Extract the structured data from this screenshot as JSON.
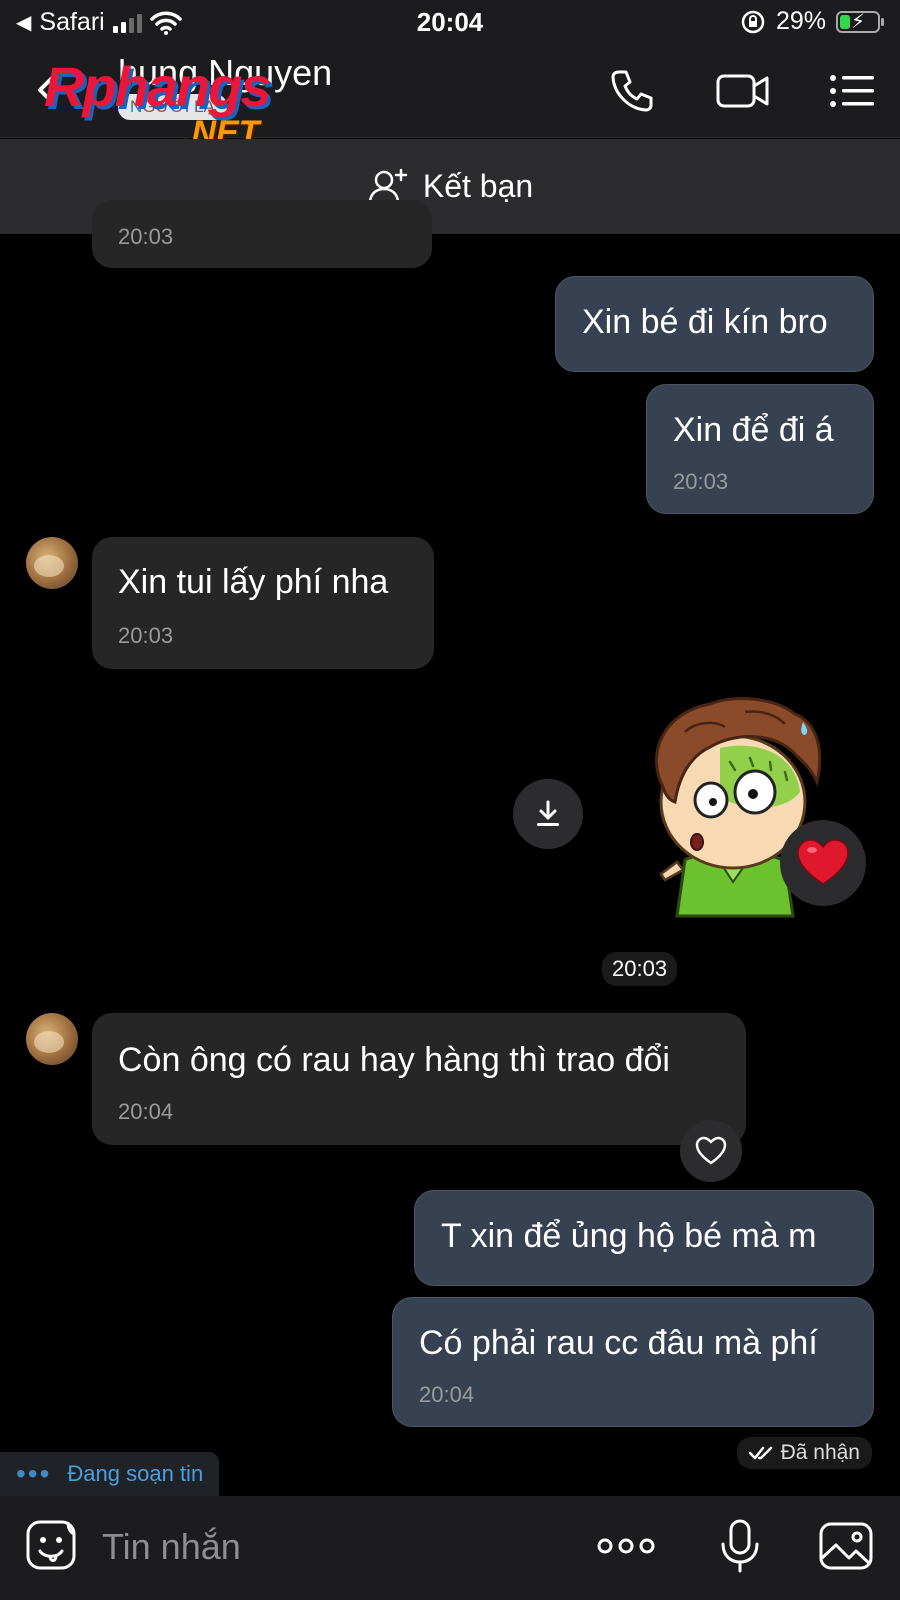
{
  "status_bar": {
    "back_app": "Safari",
    "time": "20:04",
    "battery": "29%",
    "battery_level": 0.29
  },
  "header": {
    "contact_name": "hung Nguyen",
    "badge": "NGƯỜI LẠ",
    "watermark_main": "Rphangs",
    "watermark_sub": ".NET",
    "icons": [
      "back-chevron-icon",
      "phone-icon",
      "video-camera-icon",
      "list-menu-icon"
    ]
  },
  "add_friend": {
    "label": "Kết bạn",
    "icon": "add-person-icon"
  },
  "messages": [
    {
      "direction": "in",
      "time": "20:03"
    },
    {
      "direction": "out",
      "text": "Xin bé đi kín bro"
    },
    {
      "direction": "out",
      "text": "Xin để đi á",
      "time": "20:03"
    },
    {
      "direction": "in",
      "text": "Xin tui lấy phí nha",
      "time": "20:03"
    },
    {
      "direction": "out",
      "type": "sticker",
      "reaction": "heart",
      "time": "20:03"
    },
    {
      "direction": "in",
      "text": "Còn ông có rau hay hàng thì trao đổi",
      "time": "20:04"
    },
    {
      "direction": "out",
      "text": "T xin để ủng hộ bé mà m"
    },
    {
      "direction": "out",
      "text": "Có phải rau cc đâu mà phí",
      "time": "20:04"
    }
  ],
  "receipt": "Đã nhận",
  "typing_indicator": "Đang soạn tin",
  "composer": {
    "placeholder": "Tin nhắn",
    "icons": [
      "sticker-icon",
      "more-icon",
      "microphone-icon",
      "image-icon"
    ]
  },
  "colors": {
    "background": "#000000",
    "incoming_bubble": "#262626",
    "outgoing_bubble": "#374151",
    "accent": "#4a9edc",
    "heart": "#e0182d"
  }
}
